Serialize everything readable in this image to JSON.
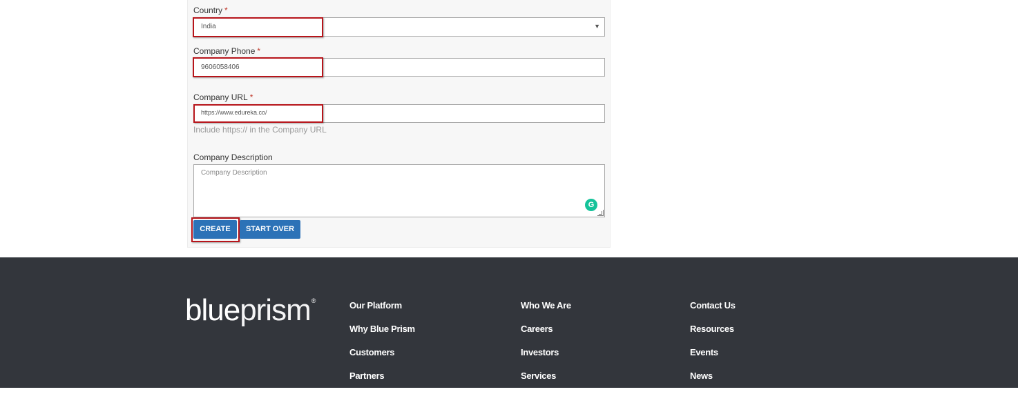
{
  "form": {
    "country_label": "Country",
    "country_value": "India",
    "phone_label": "Company Phone",
    "phone_value": "9606058406",
    "url_label": "Company URL",
    "url_value": "https://www.edureka.co/",
    "url_hint": "Include https:// in the Company URL",
    "description_label": "Company Description",
    "description_placeholder": "Company Description",
    "required_mark": "*",
    "create_label": "CREATE",
    "start_over_label": "START OVER"
  },
  "footer": {
    "logo": "blueprism",
    "logo_part1": "blue",
    "logo_part2": "prism",
    "logo_mark": "®",
    "col1": [
      "Our Platform",
      "Why Blue Prism",
      "Customers",
      "Partners"
    ],
    "col2": [
      "Who We Are",
      "Careers",
      "Investors",
      "Services"
    ],
    "col3": [
      "Contact Us",
      "Resources",
      "Events",
      "News"
    ]
  },
  "colors": {
    "button": "#2c72b7",
    "footer_bg": "#33363c",
    "highlight": "#b7141a"
  }
}
